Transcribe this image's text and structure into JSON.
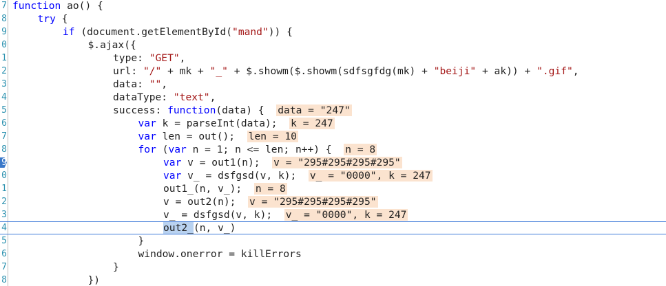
{
  "editor": {
    "lines": [
      {
        "num": "7",
        "parts": [
          [
            "kw",
            "function"
          ],
          [
            "pl",
            " ao() {"
          ]
        ]
      },
      {
        "num": "8",
        "parts": [
          [
            "kw",
            "try"
          ],
          [
            "pl",
            " {"
          ]
        ]
      },
      {
        "num": "9",
        "parts": [
          [
            "kw",
            "if"
          ],
          [
            "pl",
            " (document.getElementById("
          ],
          [
            "str",
            "\"mand\""
          ],
          [
            "pl",
            ")) {"
          ]
        ]
      },
      {
        "num": "0",
        "parts": [
          [
            "pl",
            "$.ajax({"
          ]
        ]
      },
      {
        "num": "1",
        "parts": [
          [
            "pl",
            "type: "
          ],
          [
            "str",
            "\"GET\""
          ],
          [
            "pl",
            ","
          ]
        ]
      },
      {
        "num": "2",
        "parts": [
          [
            "pl",
            "url: "
          ],
          [
            "str",
            "\"/\""
          ],
          [
            "pl",
            " + mk + "
          ],
          [
            "str",
            "\"_\""
          ],
          [
            "pl",
            " + $.showm($.showm(sdfsgfdg(mk) + "
          ],
          [
            "str",
            "\"beiji\""
          ],
          [
            "pl",
            " + ak)) + "
          ],
          [
            "str",
            "\".gif\""
          ],
          [
            "pl",
            ","
          ]
        ]
      },
      {
        "num": "3",
        "parts": [
          [
            "pl",
            "data: "
          ],
          [
            "str",
            "\"\""
          ],
          [
            "pl",
            ","
          ]
        ]
      },
      {
        "num": "4",
        "parts": [
          [
            "pl",
            "dataType: "
          ],
          [
            "str",
            "\"text\""
          ],
          [
            "pl",
            ","
          ]
        ]
      },
      {
        "num": "5",
        "parts": [
          [
            "pl",
            "success: "
          ],
          [
            "kw",
            "function"
          ],
          [
            "pl",
            "(data) {"
          ]
        ],
        "hint": "data = \"247\""
      },
      {
        "num": "6",
        "parts": [
          [
            "kw",
            "var"
          ],
          [
            "pl",
            " k = parseInt(data);"
          ]
        ],
        "hint": "k = 247"
      },
      {
        "num": "7",
        "parts": [
          [
            "kw",
            "var"
          ],
          [
            "pl",
            " len = out();"
          ]
        ],
        "hint": "len = 10"
      },
      {
        "num": "8",
        "parts": [
          [
            "kw",
            "for"
          ],
          [
            "pl",
            " ("
          ],
          [
            "kw",
            "var"
          ],
          [
            "pl",
            " n = 1; n <= len; n++) {"
          ]
        ],
        "hint": "n = 8"
      },
      {
        "num": "9",
        "parts": [
          [
            "kw",
            "var"
          ],
          [
            "pl",
            " v = out1(n);"
          ]
        ],
        "hint": "v = \"295#295#295#295\"",
        "breakpoint": true
      },
      {
        "num": "0",
        "parts": [
          [
            "kw",
            "var"
          ],
          [
            "pl",
            " v_ = dsfgsd(v, k);"
          ]
        ],
        "hint": "v_ = \"0000\", k = 247"
      },
      {
        "num": "1",
        "parts": [
          [
            "pl",
            "out1_(n, v_);"
          ]
        ],
        "hint": "n = 8"
      },
      {
        "num": "2",
        "parts": [
          [
            "pl",
            "v = out2(n);"
          ]
        ],
        "hint": "v = \"295#295#295#295\""
      },
      {
        "num": "3",
        "parts": [
          [
            "pl",
            "v_ = dsfgsd(v, k);"
          ]
        ],
        "hint": "v_ = \"0000\", k = 247"
      },
      {
        "num": "4",
        "parts": [
          [
            "sel",
            "out2_"
          ],
          [
            "pl",
            "(n, v_)"
          ]
        ],
        "current": true
      },
      {
        "num": "5",
        "parts": [
          [
            "pl",
            "}"
          ]
        ]
      },
      {
        "num": "6",
        "parts": [
          [
            "pl",
            "window.onerror = killErrors"
          ]
        ]
      },
      {
        "num": "7",
        "parts": [
          [
            "pl",
            "}"
          ]
        ]
      },
      {
        "num": "8",
        "parts": [
          [
            "pl",
            "})"
          ]
        ]
      }
    ]
  }
}
